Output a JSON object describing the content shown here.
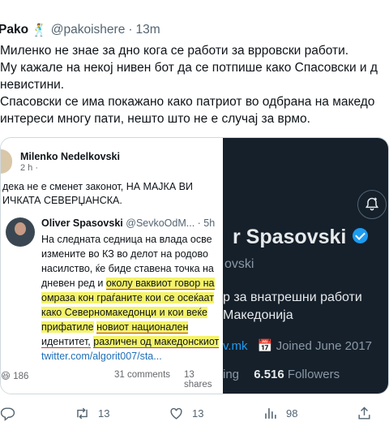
{
  "tweet": {
    "name": "Pako",
    "emoji": "🕺",
    "handle": "@pakoishere",
    "separator": "·",
    "time": "13m",
    "lines": [
      "Миленко не знае за дно кога се работи за врровски работи.",
      "Му кажале на некој нивен бот да се потпише како Спасовски и д",
      "невистини.",
      "Спасовски се има покажано како патриот во одбрана на македо",
      "интереси многу пати, нешто што не е случај за врмо."
    ]
  },
  "facebook_post": {
    "author": "Milenko Nedelkovski",
    "meta": "2 h ·",
    "text_line1": "дека не е сменет законот, НА МАЈКА ВИ",
    "text_line2": "ИЧКАТА СЕВЕРЏАНСКА.",
    "quoted": {
      "name": "Oliver Spasovski",
      "handle": "@SevkoOdM...",
      "time": "· 5h",
      "body": [
        "На следната седница на влада осве",
        "измените во КЗ во делот на родово",
        "насилство, ќе биде ставена точка на",
        "дневен ред и",
        "околу ваквиот говор на",
        "омраза кон граѓаните кои се осеќаат",
        "како Северномакедонци и кои веќе",
        "прифатиле",
        "новиот национален",
        "идентитет,",
        "различен од македонскиот",
        "twitter.com/algorit007/sta..."
      ]
    },
    "likes": "186",
    "comments": "31 comments",
    "shares": "13 shares"
  },
  "profile": {
    "name": "r Spasovski",
    "handle": "ovski",
    "bio_line1": "р за внатрешни работи",
    "bio_line2": "Македонија",
    "url": "v.mk",
    "joined": "Joined June 2017",
    "stats_prefix": "ing",
    "followers_count": "6.516",
    "followers_label": "Followers"
  },
  "actions": {
    "reply": "",
    "retweet": "13",
    "like": "13",
    "views": "98"
  },
  "colors": {
    "accent": "#1d9bf0",
    "highlight": "#f4f36a",
    "dark_bg": "#15202b"
  }
}
